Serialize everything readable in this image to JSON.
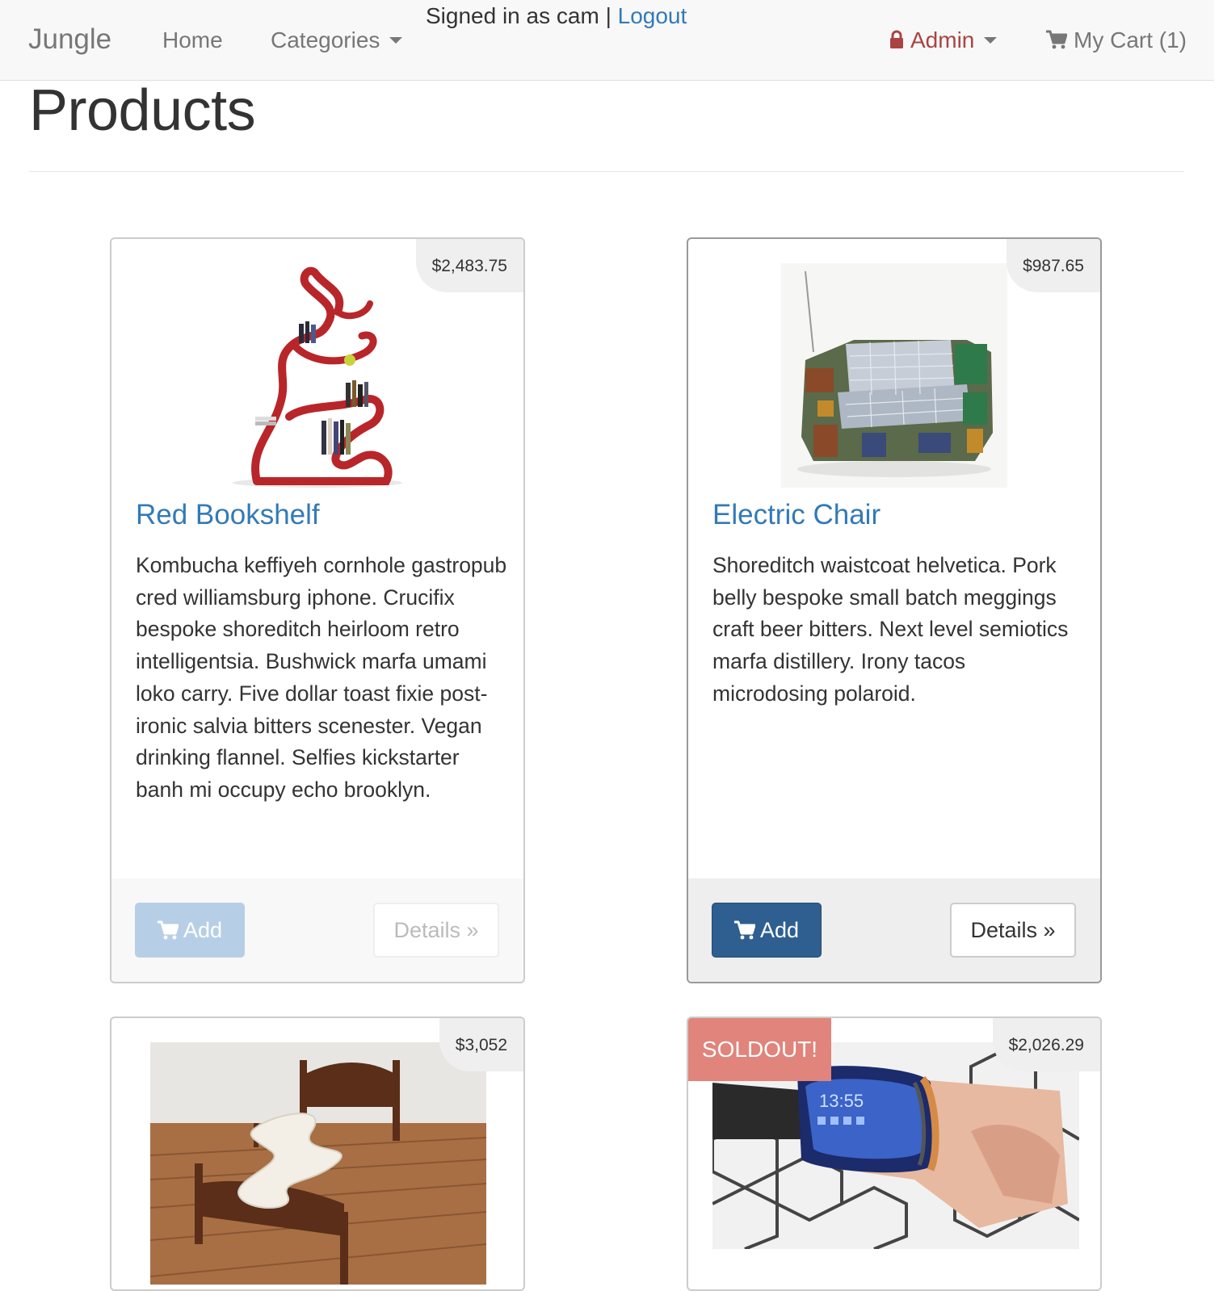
{
  "navbar": {
    "brand": "Jungle",
    "home": "Home",
    "categories": "Categories",
    "signed_in_text": "Signed in as cam |",
    "logout": "Logout",
    "admin": "Admin",
    "cart": "My Cart (1)"
  },
  "page": {
    "title": "Products"
  },
  "colors": {
    "link": "#337ab7",
    "admin": "#a94442",
    "add_button": "#2f5f91",
    "add_button_disabled": "#b7cfe6",
    "soldout": "#e0847c"
  },
  "products": [
    {
      "name": "Red Bookshelf",
      "price": "$2,483.75",
      "description": "Kombucha keffiyeh cornhole gastropub cred williamsburg iphone. Crucifix bespoke shoreditch heirloom retro intelligentsia. Bushwick marfa umami loko carry. Five dollar toast fixie post-ironic salvia bitters scenester. Vegan drinking flannel. Selfies kickstarter banh mi occupy echo brooklyn.",
      "add_label": "Add",
      "details_label": "Details »",
      "image": "red-bookshelf-image"
    },
    {
      "name": "Electric Chair",
      "price": "$987.65",
      "description": "Shoreditch waistcoat helvetica. Pork belly bespoke small batch meggings craft beer bitters. Next level semiotics marfa distillery. Irony tacos microdosing polaroid.",
      "add_label": "Add",
      "details_label": "Details »",
      "image": "electric-chair-image"
    },
    {
      "price": "$3,052",
      "image": "zigzag-bed-image"
    },
    {
      "price": "$2,026.29",
      "badge": "SOLDOUT!",
      "image": "wrist-screen-image"
    }
  ]
}
